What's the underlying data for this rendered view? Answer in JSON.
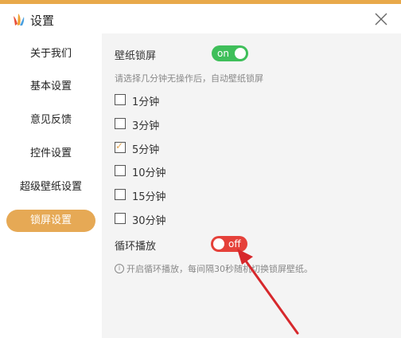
{
  "window": {
    "title": "设置"
  },
  "sidebar": {
    "items": [
      {
        "label": "关于我们"
      },
      {
        "label": "基本设置"
      },
      {
        "label": "意见反馈"
      },
      {
        "label": "控件设置"
      },
      {
        "label": "超级壁纸设置"
      },
      {
        "label": "锁屏设置",
        "active": true
      }
    ]
  },
  "lock": {
    "label": "壁纸锁屏",
    "toggle_state": "on",
    "hint": "请选择几分钟无操作后，自动壁纸锁屏",
    "options": [
      {
        "label": "1分钟",
        "checked": false
      },
      {
        "label": "3分钟",
        "checked": false
      },
      {
        "label": "5分钟",
        "checked": true
      },
      {
        "label": "10分钟",
        "checked": false
      },
      {
        "label": "15分钟",
        "checked": false
      },
      {
        "label": "30分钟",
        "checked": false
      }
    ]
  },
  "loop": {
    "label": "循环播放",
    "toggle_state": "off",
    "hint": "开启循环播放，每间隔30秒随机切换锁屏壁纸。"
  },
  "colors": {
    "accent": "#e6a955",
    "top_bar": "#e8a94a",
    "on": "#3fbf5a",
    "off": "#e5413a"
  },
  "icons": {
    "close": "close-icon",
    "logo": "app-logo-icon",
    "info": "info-icon",
    "check": "check-icon"
  }
}
